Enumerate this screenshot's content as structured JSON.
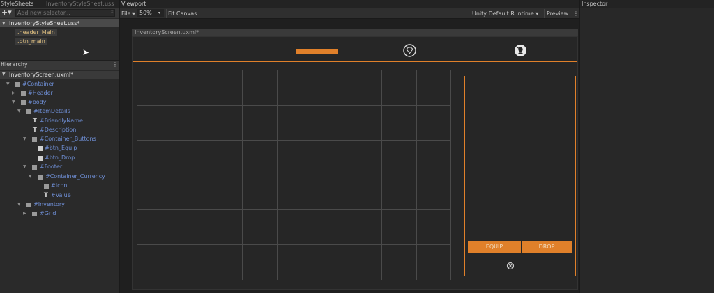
{
  "stylesheets": {
    "panel_title": "StyleSheets",
    "breadcrumb": "InventoryStyleSheet.uss",
    "add_selector_placeholder": "Add new selector...",
    "sheet_name": "InventoryStyleSheet.uss*",
    "selectors": [
      ".header_Main",
      ".btn_main"
    ]
  },
  "hierarchy": {
    "panel_title": "Hierarchy",
    "more_icon": "⋮",
    "root": "InventoryScreen.uxml*",
    "nodes": [
      {
        "label": "#Container"
      },
      {
        "label": "#Header"
      },
      {
        "label": "#body"
      },
      {
        "label": "#ItemDetails"
      },
      {
        "label": "#FriendlyName"
      },
      {
        "label": "#Description"
      },
      {
        "label": "#Container_Buttons"
      },
      {
        "label": "#btn_Equip"
      },
      {
        "label": "#btn_Drop"
      },
      {
        "label": "#Footer"
      },
      {
        "label": "#Container_Currency"
      },
      {
        "label": "#Icon"
      },
      {
        "label": "#Value"
      },
      {
        "label": "#Inventory"
      },
      {
        "label": "#Grid"
      }
    ]
  },
  "viewport": {
    "panel_title": "Viewport",
    "file_menu": "File ▾",
    "zoom": "50%",
    "zoom_arrow": "▾",
    "fit_canvas": "Fit Canvas",
    "theme": "Unity Default Runtime ▾",
    "preview": "Preview",
    "more_icon": "⋮",
    "canvas_title": "InventoryScreen.uxml*",
    "progress": 0.74,
    "equip_label": "EQUIP",
    "drop_label": "DROP",
    "colors": {
      "accent": "#e0802a",
      "canvas": "#262626"
    }
  },
  "inspector": {
    "panel_title": "Inspector"
  }
}
